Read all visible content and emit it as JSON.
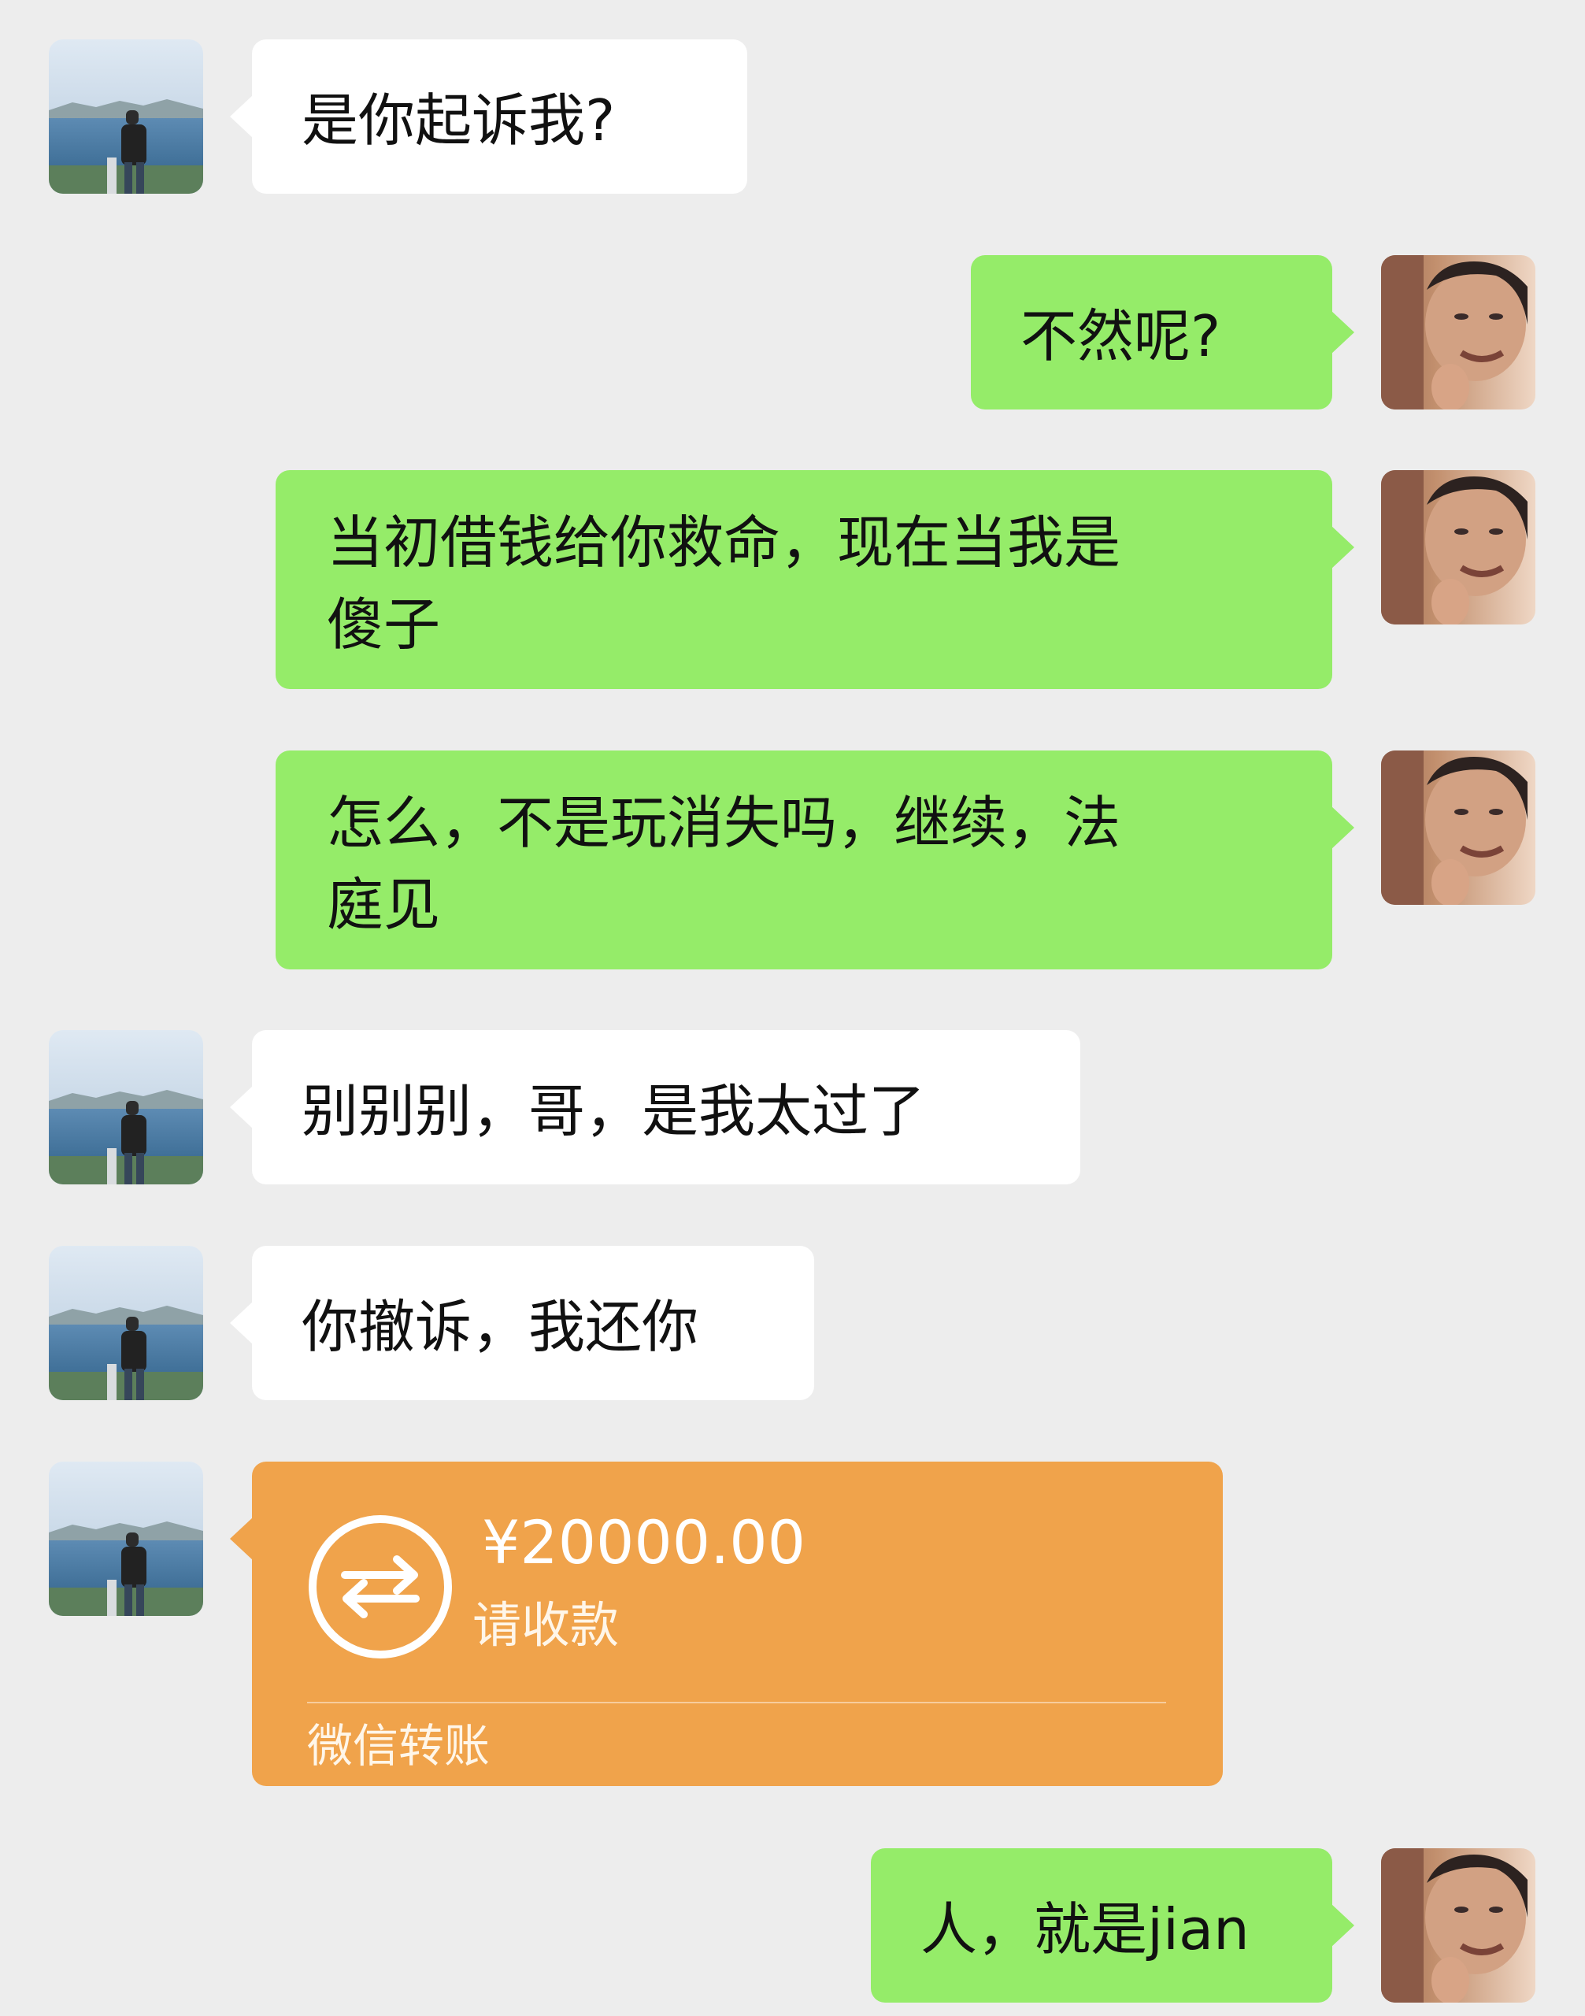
{
  "chat": {
    "messages": [
      {
        "side": "left",
        "text": "是你起诉我?"
      },
      {
        "side": "right",
        "text": "不然呢?"
      },
      {
        "side": "right",
        "line1": "当初借钱给你救命，现在当我是",
        "line2": "傻子"
      },
      {
        "side": "right",
        "line1": "怎么，不是玩消失吗，继续，法",
        "line2": "庭见"
      },
      {
        "side": "left",
        "text": "别别别，哥，是我太过了"
      },
      {
        "side": "left",
        "text": "你撤诉，我还你"
      },
      {
        "side": "right",
        "text": "人，就是jian"
      }
    ],
    "transfer": {
      "amount": "¥20000.00",
      "status": "请收款",
      "label": "微信转账",
      "icon": "transfer-arrows-icon"
    }
  }
}
